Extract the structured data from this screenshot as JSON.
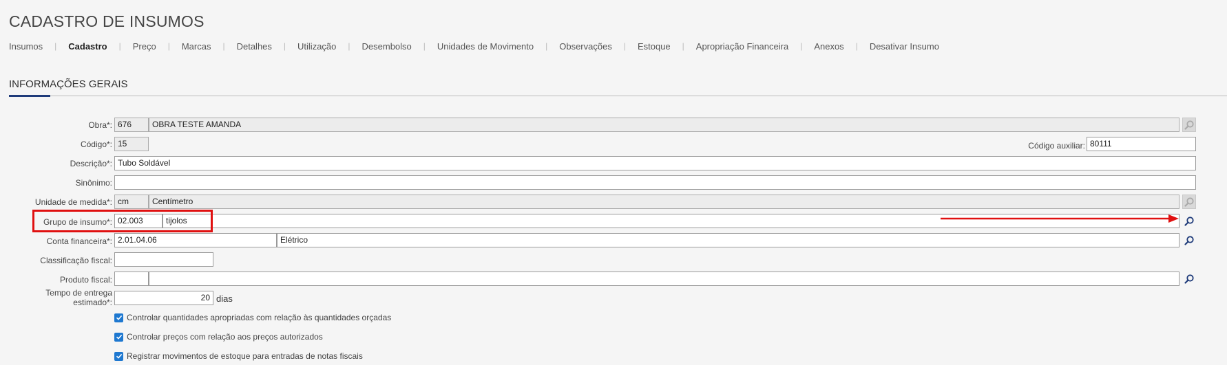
{
  "page": {
    "title": "CADASTRO DE INSUMOS"
  },
  "tabs": [
    {
      "label": "Insumos"
    },
    {
      "label": "Cadastro"
    },
    {
      "label": "Preço"
    },
    {
      "label": "Marcas"
    },
    {
      "label": "Detalhes"
    },
    {
      "label": "Utilização"
    },
    {
      "label": "Desembolso"
    },
    {
      "label": "Unidades de Movimento"
    },
    {
      "label": "Observações"
    },
    {
      "label": "Estoque"
    },
    {
      "label": "Apropriação Financeira"
    },
    {
      "label": "Anexos"
    },
    {
      "label": "Desativar Insumo"
    }
  ],
  "active_tab": "Cadastro",
  "section": {
    "title": "INFORMAÇÕES GERAIS"
  },
  "form": {
    "obra": {
      "label": "Obra*:",
      "code": "676",
      "name": "OBRA TESTE AMANDA"
    },
    "codigo": {
      "label": "Código*:",
      "value": "15"
    },
    "codigo_auxiliar": {
      "label": "Código auxiliar:",
      "value": "80111"
    },
    "descricao": {
      "label": "Descrição*:",
      "value": "Tubo Soldável"
    },
    "sinonimo": {
      "label": "Sinônimo:",
      "value": ""
    },
    "unidade_medida": {
      "label": "Unidade de medida*:",
      "code": "cm",
      "name": "Centímetro"
    },
    "grupo_insumo": {
      "label": "Grupo de insumo*:",
      "code": "02.003",
      "name": "tijolos"
    },
    "conta_financeira": {
      "label": "Conta financeira*:",
      "code": "2.01.04.06",
      "name": "Elétrico"
    },
    "classificacao_fiscal": {
      "label": "Classificação fiscal:",
      "value": ""
    },
    "produto_fiscal": {
      "label": "Produto fiscal:",
      "code": "",
      "name": ""
    },
    "tempo_entrega": {
      "label": "Tempo de entrega estimado*:",
      "value": "20",
      "unit": "dias"
    }
  },
  "checkboxes": [
    {
      "label": "Controlar quantidades apropriadas com relação às quantidades orçadas",
      "checked": true
    },
    {
      "label": "Controlar preços com relação aos preços autorizados",
      "checked": true
    },
    {
      "label": "Registrar movimentos de estoque para entradas de notas fiscais",
      "checked": true
    }
  ],
  "icons": {
    "search": "search-icon",
    "check": "check-icon"
  },
  "colors": {
    "accent": "#1f3b7a",
    "checkbox": "#1e78d0",
    "annotation": "#e01010"
  }
}
